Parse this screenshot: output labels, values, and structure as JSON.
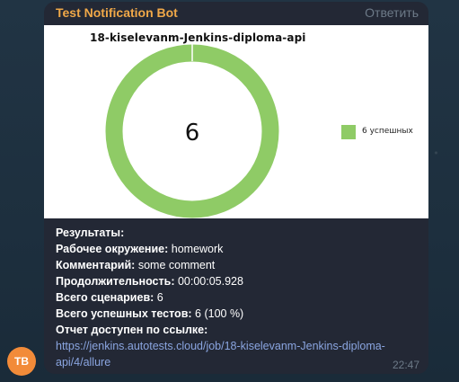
{
  "bot": {
    "name": "Test Notification Bot",
    "reply_label": "Ответить",
    "avatar_initials": "ТВ",
    "avatar_color": "#f28b39",
    "name_color": "#f0a848"
  },
  "chart_data": {
    "type": "pie",
    "title": "18-kiselevanm-Jenkins-diploma-api",
    "center_label": "6",
    "slices": [
      {
        "name": "6 успешных",
        "value": 6,
        "color": "#8fcb66"
      }
    ],
    "legend_placement": "right"
  },
  "message": {
    "results_heading": "Результаты:",
    "env_label": "Рабочее окружение:",
    "env_value": "homework",
    "comment_label": "Комментарий:",
    "comment_value": "some comment",
    "duration_label": "Продолжительность:",
    "duration_value": "00:00:05.928",
    "scenarios_label": "Всего сценариев:",
    "scenarios_value": "6",
    "passed_label": "Всего успешных тестов:",
    "passed_value": "6 (100 %)",
    "report_label": "Отчет доступен по ссылке:",
    "report_url": "https://jenkins.autotests.cloud/job/18-kiselevanm-Jenkins-diploma-api/4/allure",
    "time": "22:47"
  }
}
